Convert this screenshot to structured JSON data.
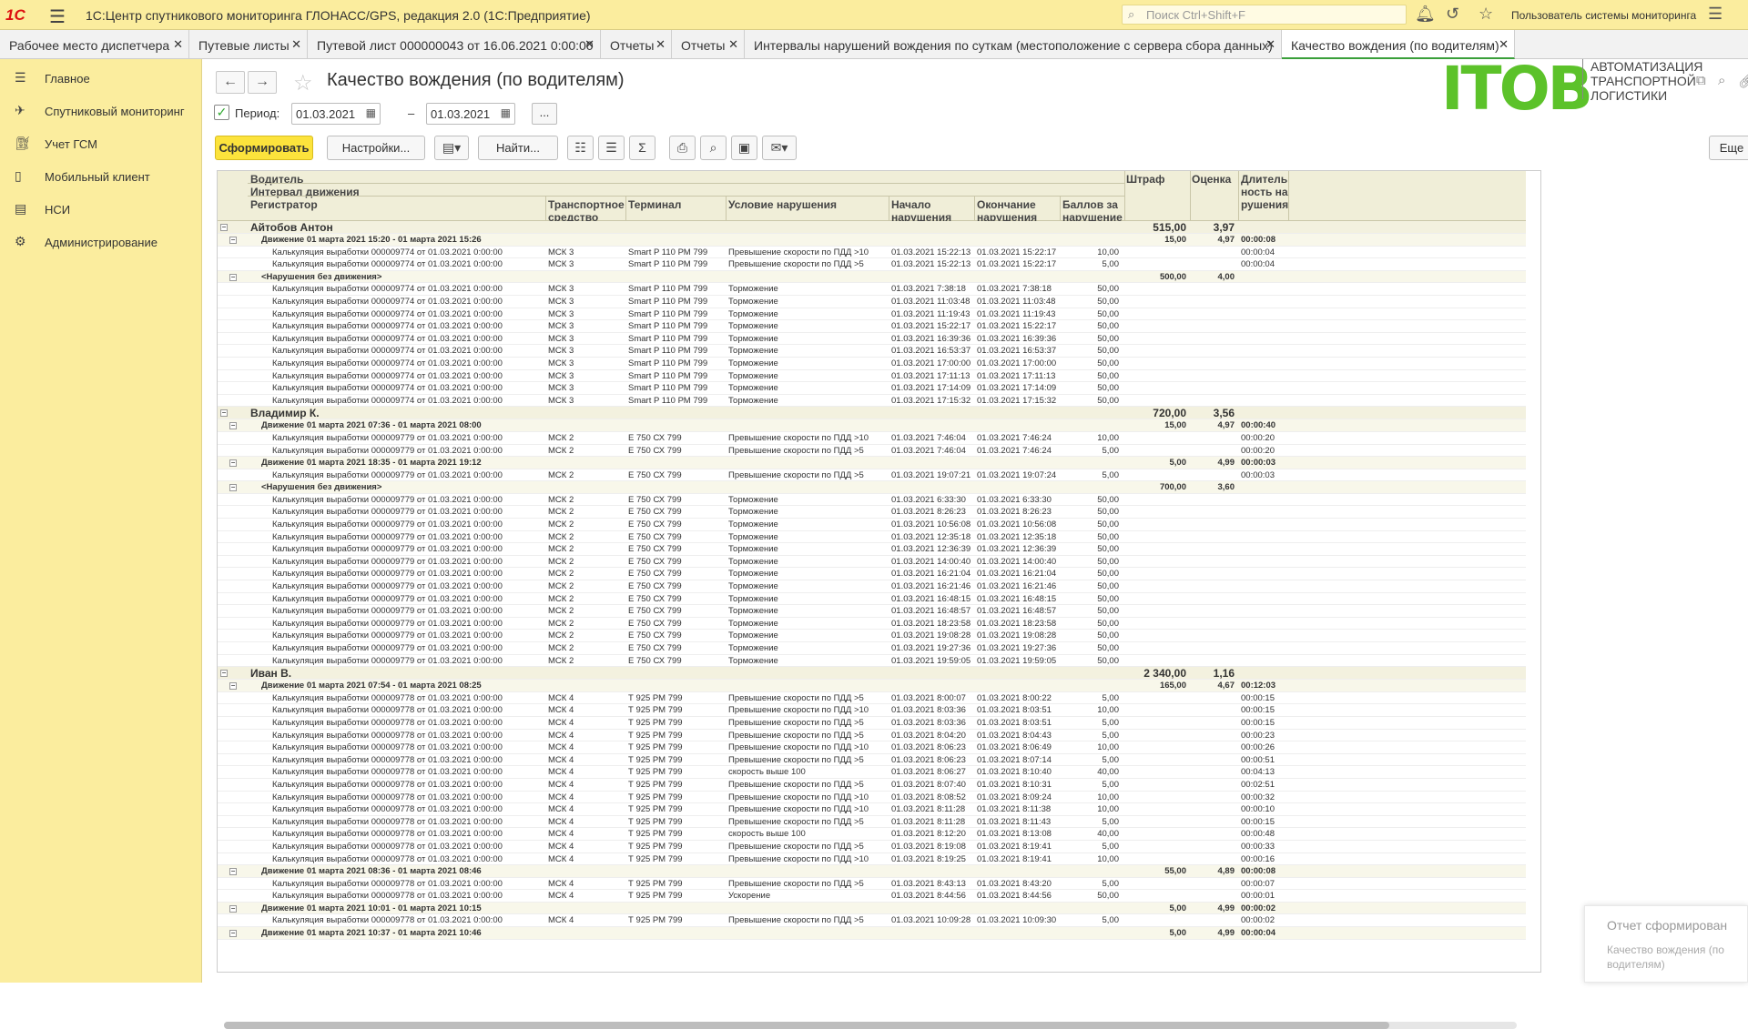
{
  "app": {
    "logo": "1С",
    "title": "1С:Центр спутникового мониторинга ГЛОНАСС/GPS, редакция 2.0  (1С:Предприятие)",
    "search_placeholder": "Поиск Ctrl+Shift+F",
    "user": "Пользователь системы мониторинга"
  },
  "tabs": [
    {
      "label": "Рабочее место диспетчера"
    },
    {
      "label": "Путевые листы"
    },
    {
      "label": "Путевой лист 000000043 от 16.06.2021 0:00:00"
    },
    {
      "label": "Отчеты"
    },
    {
      "label": "Отчеты"
    },
    {
      "label": "Интервалы нарушений вождения по суткам (местоположение с сервера сбора данных)"
    },
    {
      "label": "Качество вождения (по водителям)"
    }
  ],
  "sidebar": {
    "items": [
      {
        "label": "Главное",
        "icon": "menu-icon"
      },
      {
        "label": "Спутниковый мониторинг",
        "icon": "satellite-icon"
      },
      {
        "label": "Учет ГСМ",
        "icon": "fuel-icon"
      },
      {
        "label": "Мобильный клиент",
        "icon": "phone-icon"
      },
      {
        "label": "НСИ",
        "icon": "book-icon"
      },
      {
        "label": "Администрирование",
        "icon": "gear-icon"
      }
    ]
  },
  "page": {
    "title": "Качество вождения (по водителям)",
    "brand": "ITOB",
    "brand_sub": "АВТОМАТИЗАЦИЯ ТРАНСПОРТНОЙ ЛОГИСТИКИ"
  },
  "period": {
    "label": "Период:",
    "from": "01.03.2021",
    "to": "01.03.2021",
    "dash": "–",
    "more": "..."
  },
  "toolbar": {
    "generate": "Сформировать",
    "settings": "Настройки...",
    "find": "Найти...",
    "more": "Еще"
  },
  "headers": {
    "driver": "Водитель",
    "interval": "Интервал движения",
    "registrar": "Регистратор",
    "vehicle": "Транспортное средство",
    "terminal": "Терминал",
    "condition": "Условие нарушения",
    "start": "Начало нарушения",
    "end": "Окончание нарушения",
    "points": "Баллов за нарушение",
    "fine": "Штраф",
    "score": "Оценка",
    "duration": "Длительность нарушения"
  },
  "rows": [
    {
      "t": "d",
      "name": "Айтобов Антон",
      "fine": "515,00",
      "score": "3,97"
    },
    {
      "t": "i",
      "name": "Движение 01 марта 2021 15:20 - 01 марта 2021 15:26",
      "fine": "15,00",
      "score": "4,97",
      "dur": "00:00:08"
    },
    {
      "t": "r",
      "reg": "Калькуляция выработки 000009774 от 01.03.2021 0:00:00",
      "veh": "МСК 3",
      "term": "Smart P 110 РМ 799",
      "cond": "Превышение скорости по ПДД >10",
      "start": "01.03.2021 15:22:13",
      "end": "01.03.2021 15:22:17",
      "pts": "10,00",
      "dur": "00:00:04"
    },
    {
      "t": "r",
      "reg": "Калькуляция выработки 000009774 от 01.03.2021 0:00:00",
      "veh": "МСК 3",
      "term": "Smart P 110 РМ 799",
      "cond": "Превышение скорости по ПДД >5",
      "start": "01.03.2021 15:22:13",
      "end": "01.03.2021 15:22:17",
      "pts": "5,00",
      "dur": "00:00:04"
    },
    {
      "t": "i",
      "name": "<Нарушения без движения>",
      "fine": "500,00",
      "score": "4,00"
    },
    {
      "t": "r",
      "reg": "Калькуляция выработки 000009774 от 01.03.2021 0:00:00",
      "veh": "МСК 3",
      "term": "Smart P 110 РМ 799",
      "cond": "Торможение",
      "start": "01.03.2021 7:38:18",
      "end": "01.03.2021 7:38:18",
      "pts": "50,00"
    },
    {
      "t": "r",
      "reg": "Калькуляция выработки 000009774 от 01.03.2021 0:00:00",
      "veh": "МСК 3",
      "term": "Smart P 110 РМ 799",
      "cond": "Торможение",
      "start": "01.03.2021 11:03:48",
      "end": "01.03.2021 11:03:48",
      "pts": "50,00"
    },
    {
      "t": "r",
      "reg": "Калькуляция выработки 000009774 от 01.03.2021 0:00:00",
      "veh": "МСК 3",
      "term": "Smart P 110 РМ 799",
      "cond": "Торможение",
      "start": "01.03.2021 11:19:43",
      "end": "01.03.2021 11:19:43",
      "pts": "50,00"
    },
    {
      "t": "r",
      "reg": "Калькуляция выработки 000009774 от 01.03.2021 0:00:00",
      "veh": "МСК 3",
      "term": "Smart P 110 РМ 799",
      "cond": "Торможение",
      "start": "01.03.2021 15:22:17",
      "end": "01.03.2021 15:22:17",
      "pts": "50,00"
    },
    {
      "t": "r",
      "reg": "Калькуляция выработки 000009774 от 01.03.2021 0:00:00",
      "veh": "МСК 3",
      "term": "Smart P 110 РМ 799",
      "cond": "Торможение",
      "start": "01.03.2021 16:39:36",
      "end": "01.03.2021 16:39:36",
      "pts": "50,00"
    },
    {
      "t": "r",
      "reg": "Калькуляция выработки 000009774 от 01.03.2021 0:00:00",
      "veh": "МСК 3",
      "term": "Smart P 110 РМ 799",
      "cond": "Торможение",
      "start": "01.03.2021 16:53:37",
      "end": "01.03.2021 16:53:37",
      "pts": "50,00"
    },
    {
      "t": "r",
      "reg": "Калькуляция выработки 000009774 от 01.03.2021 0:00:00",
      "veh": "МСК 3",
      "term": "Smart P 110 РМ 799",
      "cond": "Торможение",
      "start": "01.03.2021 17:00:00",
      "end": "01.03.2021 17:00:00",
      "pts": "50,00"
    },
    {
      "t": "r",
      "reg": "Калькуляция выработки 000009774 от 01.03.2021 0:00:00",
      "veh": "МСК 3",
      "term": "Smart P 110 РМ 799",
      "cond": "Торможение",
      "start": "01.03.2021 17:11:13",
      "end": "01.03.2021 17:11:13",
      "pts": "50,00"
    },
    {
      "t": "r",
      "reg": "Калькуляция выработки 000009774 от 01.03.2021 0:00:00",
      "veh": "МСК 3",
      "term": "Smart P 110 РМ 799",
      "cond": "Торможение",
      "start": "01.03.2021 17:14:09",
      "end": "01.03.2021 17:14:09",
      "pts": "50,00"
    },
    {
      "t": "r",
      "reg": "Калькуляция выработки 000009774 от 01.03.2021 0:00:00",
      "veh": "МСК 3",
      "term": "Smart P 110 РМ 799",
      "cond": "Торможение",
      "start": "01.03.2021 17:15:32",
      "end": "01.03.2021 17:15:32",
      "pts": "50,00"
    },
    {
      "t": "d",
      "name": "Владимир К.",
      "fine": "720,00",
      "score": "3,56"
    },
    {
      "t": "i",
      "name": "Движение 01 марта 2021 07:36 - 01 марта 2021 08:00",
      "fine": "15,00",
      "score": "4,97",
      "dur": "00:00:40"
    },
    {
      "t": "r",
      "reg": "Калькуляция выработки 000009779 от 01.03.2021 0:00:00",
      "veh": "МСК 2",
      "term": "Е 750 СХ 799",
      "cond": "Превышение скорости по ПДД >10",
      "start": "01.03.2021 7:46:04",
      "end": "01.03.2021 7:46:24",
      "pts": "10,00",
      "dur": "00:00:20"
    },
    {
      "t": "r",
      "reg": "Калькуляция выработки 000009779 от 01.03.2021 0:00:00",
      "veh": "МСК 2",
      "term": "Е 750 СХ 799",
      "cond": "Превышение скорости по ПДД >5",
      "start": "01.03.2021 7:46:04",
      "end": "01.03.2021 7:46:24",
      "pts": "5,00",
      "dur": "00:00:20"
    },
    {
      "t": "i",
      "name": "Движение 01 марта 2021 18:35 - 01 марта 2021 19:12",
      "fine": "5,00",
      "score": "4,99",
      "dur": "00:00:03"
    },
    {
      "t": "r",
      "reg": "Калькуляция выработки 000009779 от 01.03.2021 0:00:00",
      "veh": "МСК 2",
      "term": "Е 750 СХ 799",
      "cond": "Превышение скорости по ПДД >5",
      "start": "01.03.2021 19:07:21",
      "end": "01.03.2021 19:07:24",
      "pts": "5,00",
      "dur": "00:00:03"
    },
    {
      "t": "i",
      "name": "<Нарушения без движения>",
      "fine": "700,00",
      "score": "3,60"
    },
    {
      "t": "r",
      "reg": "Калькуляция выработки 000009779 от 01.03.2021 0:00:00",
      "veh": "МСК 2",
      "term": "Е 750 СХ 799",
      "cond": "Торможение",
      "start": "01.03.2021 6:33:30",
      "end": "01.03.2021 6:33:30",
      "pts": "50,00"
    },
    {
      "t": "r",
      "reg": "Калькуляция выработки 000009779 от 01.03.2021 0:00:00",
      "veh": "МСК 2",
      "term": "Е 750 СХ 799",
      "cond": "Торможение",
      "start": "01.03.2021 8:26:23",
      "end": "01.03.2021 8:26:23",
      "pts": "50,00"
    },
    {
      "t": "r",
      "reg": "Калькуляция выработки 000009779 от 01.03.2021 0:00:00",
      "veh": "МСК 2",
      "term": "Е 750 СХ 799",
      "cond": "Торможение",
      "start": "01.03.2021 10:56:08",
      "end": "01.03.2021 10:56:08",
      "pts": "50,00"
    },
    {
      "t": "r",
      "reg": "Калькуляция выработки 000009779 от 01.03.2021 0:00:00",
      "veh": "МСК 2",
      "term": "Е 750 СХ 799",
      "cond": "Торможение",
      "start": "01.03.2021 12:35:18",
      "end": "01.03.2021 12:35:18",
      "pts": "50,00"
    },
    {
      "t": "r",
      "reg": "Калькуляция выработки 000009779 от 01.03.2021 0:00:00",
      "veh": "МСК 2",
      "term": "Е 750 СХ 799",
      "cond": "Торможение",
      "start": "01.03.2021 12:36:39",
      "end": "01.03.2021 12:36:39",
      "pts": "50,00"
    },
    {
      "t": "r",
      "reg": "Калькуляция выработки 000009779 от 01.03.2021 0:00:00",
      "veh": "МСК 2",
      "term": "Е 750 СХ 799",
      "cond": "Торможение",
      "start": "01.03.2021 14:00:40",
      "end": "01.03.2021 14:00:40",
      "pts": "50,00"
    },
    {
      "t": "r",
      "reg": "Калькуляция выработки 000009779 от 01.03.2021 0:00:00",
      "veh": "МСК 2",
      "term": "Е 750 СХ 799",
      "cond": "Торможение",
      "start": "01.03.2021 16:21:04",
      "end": "01.03.2021 16:21:04",
      "pts": "50,00"
    },
    {
      "t": "r",
      "reg": "Калькуляция выработки 000009779 от 01.03.2021 0:00:00",
      "veh": "МСК 2",
      "term": "Е 750 СХ 799",
      "cond": "Торможение",
      "start": "01.03.2021 16:21:46",
      "end": "01.03.2021 16:21:46",
      "pts": "50,00"
    },
    {
      "t": "r",
      "reg": "Калькуляция выработки 000009779 от 01.03.2021 0:00:00",
      "veh": "МСК 2",
      "term": "Е 750 СХ 799",
      "cond": "Торможение",
      "start": "01.03.2021 16:48:15",
      "end": "01.03.2021 16:48:15",
      "pts": "50,00"
    },
    {
      "t": "r",
      "reg": "Калькуляция выработки 000009779 от 01.03.2021 0:00:00",
      "veh": "МСК 2",
      "term": "Е 750 СХ 799",
      "cond": "Торможение",
      "start": "01.03.2021 16:48:57",
      "end": "01.03.2021 16:48:57",
      "pts": "50,00"
    },
    {
      "t": "r",
      "reg": "Калькуляция выработки 000009779 от 01.03.2021 0:00:00",
      "veh": "МСК 2",
      "term": "Е 750 СХ 799",
      "cond": "Торможение",
      "start": "01.03.2021 18:23:58",
      "end": "01.03.2021 18:23:58",
      "pts": "50,00"
    },
    {
      "t": "r",
      "reg": "Калькуляция выработки 000009779 от 01.03.2021 0:00:00",
      "veh": "МСК 2",
      "term": "Е 750 СХ 799",
      "cond": "Торможение",
      "start": "01.03.2021 19:08:28",
      "end": "01.03.2021 19:08:28",
      "pts": "50,00"
    },
    {
      "t": "r",
      "reg": "Калькуляция выработки 000009779 от 01.03.2021 0:00:00",
      "veh": "МСК 2",
      "term": "Е 750 СХ 799",
      "cond": "Торможение",
      "start": "01.03.2021 19:27:36",
      "end": "01.03.2021 19:27:36",
      "pts": "50,00"
    },
    {
      "t": "r",
      "reg": "Калькуляция выработки 000009779 от 01.03.2021 0:00:00",
      "veh": "МСК 2",
      "term": "Е 750 СХ 799",
      "cond": "Торможение",
      "start": "01.03.2021 19:59:05",
      "end": "01.03.2021 19:59:05",
      "pts": "50,00"
    },
    {
      "t": "d",
      "name": "Иван В.",
      "fine": "2 340,00",
      "score": "1,16"
    },
    {
      "t": "i",
      "name": "Движение 01 марта 2021 07:54 - 01 марта 2021 08:25",
      "fine": "165,00",
      "score": "4,67",
      "dur": "00:12:03"
    },
    {
      "t": "r",
      "reg": "Калькуляция выработки 000009778 от 01.03.2021 0:00:00",
      "veh": "МСК 4",
      "term": "Т 925 РМ 799",
      "cond": "Превышение скорости по ПДД >5",
      "start": "01.03.2021 8:00:07",
      "end": "01.03.2021 8:00:22",
      "pts": "5,00",
      "dur": "00:00:15"
    },
    {
      "t": "r",
      "reg": "Калькуляция выработки 000009778 от 01.03.2021 0:00:00",
      "veh": "МСК 4",
      "term": "Т 925 РМ 799",
      "cond": "Превышение скорости по ПДД >10",
      "start": "01.03.2021 8:03:36",
      "end": "01.03.2021 8:03:51",
      "pts": "10,00",
      "dur": "00:00:15"
    },
    {
      "t": "r",
      "reg": "Калькуляция выработки 000009778 от 01.03.2021 0:00:00",
      "veh": "МСК 4",
      "term": "Т 925 РМ 799",
      "cond": "Превышение скорости по ПДД >5",
      "start": "01.03.2021 8:03:36",
      "end": "01.03.2021 8:03:51",
      "pts": "5,00",
      "dur": "00:00:15"
    },
    {
      "t": "r",
      "reg": "Калькуляция выработки 000009778 от 01.03.2021 0:00:00",
      "veh": "МСК 4",
      "term": "Т 925 РМ 799",
      "cond": "Превышение скорости по ПДД >5",
      "start": "01.03.2021 8:04:20",
      "end": "01.03.2021 8:04:43",
      "pts": "5,00",
      "dur": "00:00:23"
    },
    {
      "t": "r",
      "reg": "Калькуляция выработки 000009778 от 01.03.2021 0:00:00",
      "veh": "МСК 4",
      "term": "Т 925 РМ 799",
      "cond": "Превышение скорости по ПДД >10",
      "start": "01.03.2021 8:06:23",
      "end": "01.03.2021 8:06:49",
      "pts": "10,00",
      "dur": "00:00:26"
    },
    {
      "t": "r",
      "reg": "Калькуляция выработки 000009778 от 01.03.2021 0:00:00",
      "veh": "МСК 4",
      "term": "Т 925 РМ 799",
      "cond": "Превышение скорости по ПДД >5",
      "start": "01.03.2021 8:06:23",
      "end": "01.03.2021 8:07:14",
      "pts": "5,00",
      "dur": "00:00:51"
    },
    {
      "t": "r",
      "reg": "Калькуляция выработки 000009778 от 01.03.2021 0:00:00",
      "veh": "МСК 4",
      "term": "Т 925 РМ 799",
      "cond": "скорость выше 100",
      "start": "01.03.2021 8:06:27",
      "end": "01.03.2021 8:10:40",
      "pts": "40,00",
      "dur": "00:04:13"
    },
    {
      "t": "r",
      "reg": "Калькуляция выработки 000009778 от 01.03.2021 0:00:00",
      "veh": "МСК 4",
      "term": "Т 925 РМ 799",
      "cond": "Превышение скорости по ПДД >5",
      "start": "01.03.2021 8:07:40",
      "end": "01.03.2021 8:10:31",
      "pts": "5,00",
      "dur": "00:02:51"
    },
    {
      "t": "r",
      "reg": "Калькуляция выработки 000009778 от 01.03.2021 0:00:00",
      "veh": "МСК 4",
      "term": "Т 925 РМ 799",
      "cond": "Превышение скорости по ПДД >10",
      "start": "01.03.2021 8:08:52",
      "end": "01.03.2021 8:09:24",
      "pts": "10,00",
      "dur": "00:00:32"
    },
    {
      "t": "r",
      "reg": "Калькуляция выработки 000009778 от 01.03.2021 0:00:00",
      "veh": "МСК 4",
      "term": "Т 925 РМ 799",
      "cond": "Превышение скорости по ПДД >10",
      "start": "01.03.2021 8:11:28",
      "end": "01.03.2021 8:11:38",
      "pts": "10,00",
      "dur": "00:00:10"
    },
    {
      "t": "r",
      "reg": "Калькуляция выработки 000009778 от 01.03.2021 0:00:00",
      "veh": "МСК 4",
      "term": "Т 925 РМ 799",
      "cond": "Превышение скорости по ПДД >5",
      "start": "01.03.2021 8:11:28",
      "end": "01.03.2021 8:11:43",
      "pts": "5,00",
      "dur": "00:00:15"
    },
    {
      "t": "r",
      "reg": "Калькуляция выработки 000009778 от 01.03.2021 0:00:00",
      "veh": "МСК 4",
      "term": "Т 925 РМ 799",
      "cond": "скорость выше 100",
      "start": "01.03.2021 8:12:20",
      "end": "01.03.2021 8:13:08",
      "pts": "40,00",
      "dur": "00:00:48"
    },
    {
      "t": "r",
      "reg": "Калькуляция выработки 000009778 от 01.03.2021 0:00:00",
      "veh": "МСК 4",
      "term": "Т 925 РМ 799",
      "cond": "Превышение скорости по ПДД >5",
      "start": "01.03.2021 8:19:08",
      "end": "01.03.2021 8:19:41",
      "pts": "5,00",
      "dur": "00:00:33"
    },
    {
      "t": "r",
      "reg": "Калькуляция выработки 000009778 от 01.03.2021 0:00:00",
      "veh": "МСК 4",
      "term": "Т 925 РМ 799",
      "cond": "Превышение скорости по ПДД >10",
      "start": "01.03.2021 8:19:25",
      "end": "01.03.2021 8:19:41",
      "pts": "10,00",
      "dur": "00:00:16"
    },
    {
      "t": "i",
      "name": "Движение 01 марта 2021 08:36 - 01 марта 2021 08:46",
      "fine": "55,00",
      "score": "4,89",
      "dur": "00:00:08"
    },
    {
      "t": "r",
      "reg": "Калькуляция выработки 000009778 от 01.03.2021 0:00:00",
      "veh": "МСК 4",
      "term": "Т 925 РМ 799",
      "cond": "Превышение скорости по ПДД >5",
      "start": "01.03.2021 8:43:13",
      "end": "01.03.2021 8:43:20",
      "pts": "5,00",
      "dur": "00:00:07"
    },
    {
      "t": "r",
      "reg": "Калькуляция выработки 000009778 от 01.03.2021 0:00:00",
      "veh": "МСК 4",
      "term": "Т 925 РМ 799",
      "cond": "Ускорение",
      "start": "01.03.2021 8:44:56",
      "end": "01.03.2021 8:44:56",
      "pts": "50,00",
      "dur": "00:00:01"
    },
    {
      "t": "i",
      "name": "Движение 01 марта 2021 10:01 - 01 марта 2021 10:15",
      "fine": "5,00",
      "score": "4,99",
      "dur": "00:00:02"
    },
    {
      "t": "r",
      "reg": "Калькуляция выработки 000009778 от 01.03.2021 0:00:00",
      "veh": "МСК 4",
      "term": "Т 925 РМ 799",
      "cond": "Превышение скорости по ПДД >5",
      "start": "01.03.2021 10:09:28",
      "end": "01.03.2021 10:09:30",
      "pts": "5,00",
      "dur": "00:00:02"
    },
    {
      "t": "i",
      "name": "Движение 01 марта 2021 10:37 - 01 марта 2021 10:46",
      "fine": "5,00",
      "score": "4,99",
      "dur": "00:00:04"
    }
  ],
  "toast": {
    "title": "Отчет сформирован",
    "text": "Качество вождения (по водителям)"
  }
}
